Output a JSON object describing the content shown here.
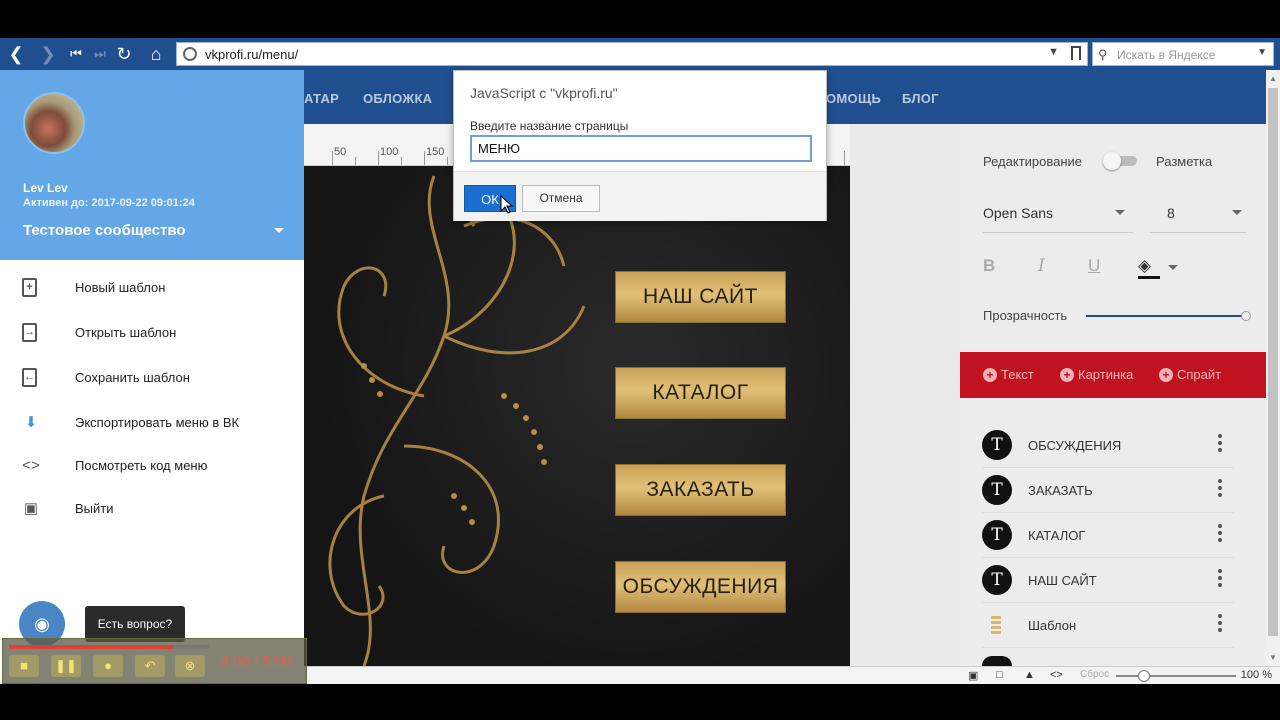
{
  "browser": {
    "url": "vkprofi.ru/menu/",
    "search_placeholder": "Искать в Яндексе"
  },
  "topnav": [
    "АТАР",
    "ОБЛОЖКА",
    "ОМОЩЬ",
    "БЛОГ"
  ],
  "drawer": {
    "user_name": "Lev Lev",
    "active_until": "Активен до: 2017-09-22 09:01:24",
    "community": "Тестовое сообщество",
    "items": [
      {
        "label": "Новый шаблон",
        "icon": "file-plus-icon"
      },
      {
        "label": "Открыть шаблон",
        "icon": "file-open-icon"
      },
      {
        "label": "Сохранить шаблон",
        "icon": "file-save-icon"
      },
      {
        "label": "Экспортировать меню в ВК",
        "icon": "download-icon"
      },
      {
        "label": "Посмотреть код меню",
        "icon": "code-icon"
      },
      {
        "label": "Выйти",
        "icon": "account-icon"
      }
    ],
    "help_tooltip": "Есть вопрос?"
  },
  "ruler": [
    "50",
    "100",
    "150"
  ],
  "canvas": {
    "buttons": [
      "НАШ САЙТ",
      "КАТАЛОГ",
      "ЗАКАЗАТЬ",
      "ОБСУЖДЕНИЯ"
    ]
  },
  "panel": {
    "edit_label": "Редактирование",
    "markup_label": "Разметка",
    "font_family": "Open Sans",
    "font_size": "8",
    "opacity_label": "Прозрачность",
    "opacity_value": 1.0,
    "add_text": "Текст",
    "add_image": "Картинка",
    "add_sprite": "Спрайт",
    "accent_color": "#c0121f",
    "layers": [
      "ОБСУЖДЕНИЯ",
      "ЗАКАЗАТЬ",
      "КАТАЛОГ",
      "НАШ САЙТ",
      "Шаблон"
    ]
  },
  "statusbar": {
    "reset": "Сброс",
    "zoom": "100 %"
  },
  "recorder": {
    "time": "4:06 / 5:00",
    "progress": 0.82
  },
  "dialog": {
    "title": "JavaScript с \"vkprofi.ru\"",
    "prompt": "Введите название страницы",
    "value": "МЕНЮ",
    "ok": "ОК",
    "cancel": "Отмена"
  }
}
